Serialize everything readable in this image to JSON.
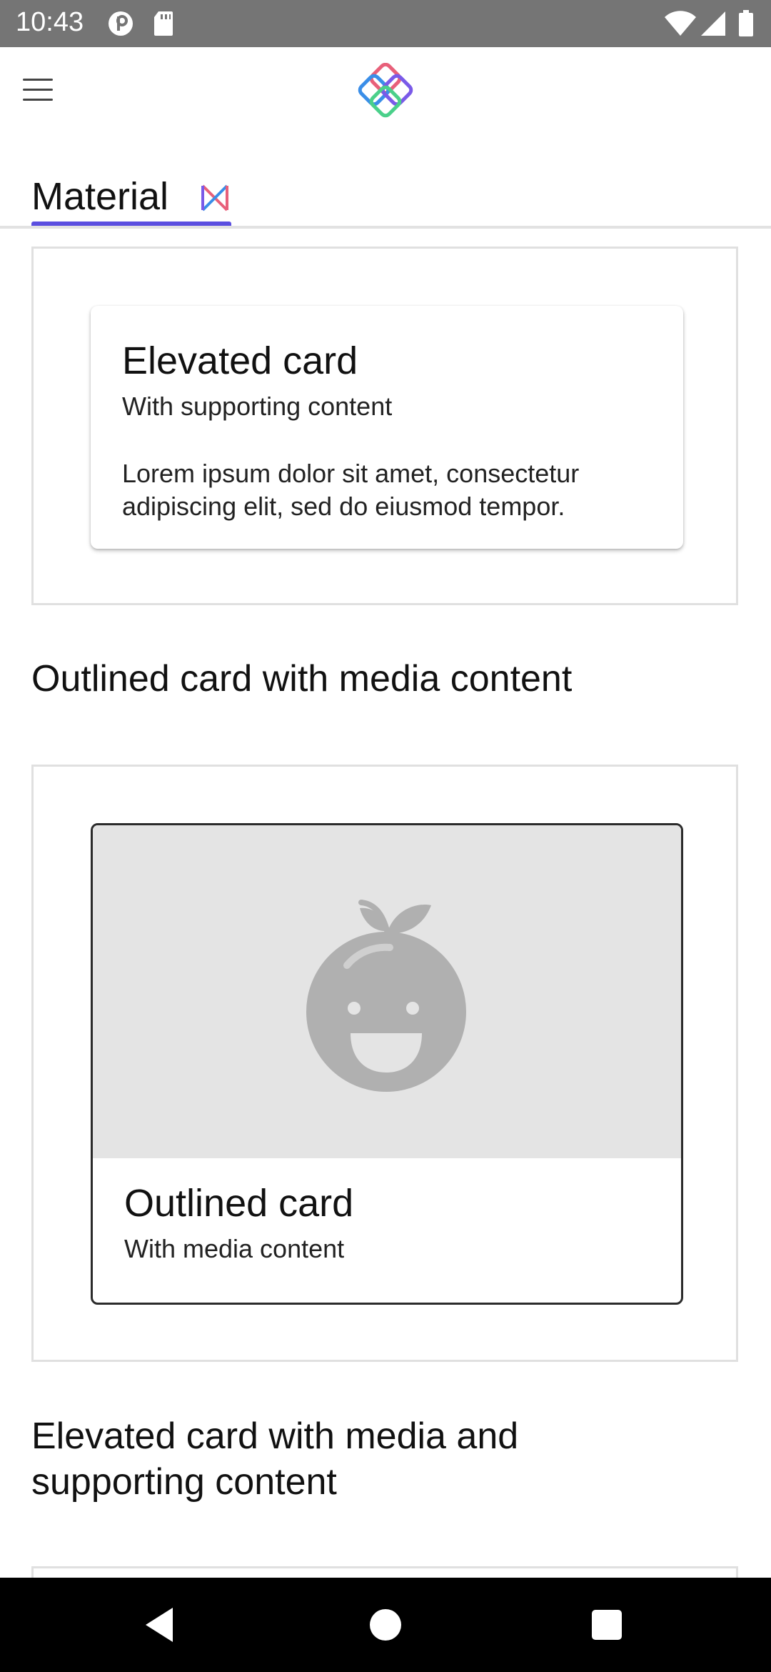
{
  "status_bar": {
    "time": "10:43",
    "icons": [
      "app-notification-icon",
      "sd-card-icon",
      "wifi-icon",
      "cellular-signal-icon",
      "battery-icon"
    ]
  },
  "app_bar": {
    "menu_icon": "hamburger-menu-icon",
    "logo_icon": "app-logo-icon"
  },
  "tabs": [
    {
      "label": "Material",
      "icon": "material-logo-icon",
      "selected": true
    }
  ],
  "demos": {
    "elevated_card": {
      "title": "Elevated card",
      "subtitle": "With supporting content",
      "body": "Lorem ipsum dolor sit amet, consectetur adipiscing elit, sed do eiusmod tempor."
    },
    "outlined_media": {
      "heading": "Outlined card with media content",
      "card_title": "Outlined card",
      "card_subtitle": "With media content",
      "media_icon": "fruit-placeholder-icon"
    },
    "elevated_media": {
      "heading": "Elevated card with media and supporting content"
    }
  },
  "nav_bar": {
    "buttons": [
      "back-icon",
      "home-icon",
      "recents-icon"
    ]
  },
  "colors": {
    "status_bar": "#757575",
    "tab_indicator": "#5b4fe0",
    "nav_bar": "#000000",
    "media_background": "#e4e4e4"
  }
}
